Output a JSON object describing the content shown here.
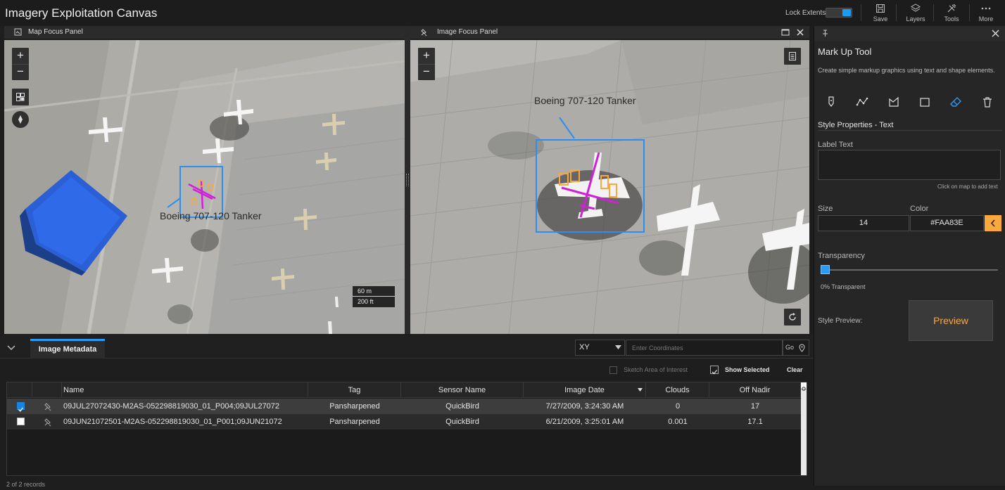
{
  "app": {
    "title": "Imagery Exploitation Canvas"
  },
  "header": {
    "lock_extents_label": "Lock Extents",
    "lock_extents_on": true,
    "tools": [
      {
        "label": "Save",
        "icon": "save-icon"
      },
      {
        "label": "Layers",
        "icon": "layers-icon"
      },
      {
        "label": "Tools",
        "icon": "tools-icon"
      },
      {
        "label": "More",
        "icon": "more-icon"
      }
    ]
  },
  "map_panel": {
    "title": "Map Focus Panel",
    "annotation_label": "Boeing 707-120 Tanker",
    "scale_m": "60 m",
    "scale_ft": "200 ft"
  },
  "image_panel": {
    "title": "Image Focus Panel",
    "annotation_label": "Boeing 707-120 Tanker"
  },
  "markup": {
    "title": "Mark Up Tool",
    "description": "Create simple markup graphics using text and shape elements.",
    "style_props_title": "Style Properties - Text",
    "label_text_label": "Label Text",
    "label_text_value": "",
    "hint": "Click on map to add text",
    "size_label": "Size",
    "size_value": "14",
    "color_label": "Color",
    "color_value": "#FAA83E",
    "transparency_label": "Transparency",
    "transparency_value": "0% Transparent",
    "transparency_fraction": 0,
    "style_preview_label": "Style Preview:",
    "preview_text": "Preview",
    "accent": "#faa83e",
    "active_tool": "eraser-icon"
  },
  "bottom": {
    "tab_label": "Image Metadata",
    "coord_mode": "XY",
    "coord_placeholder": "Enter Coordinates",
    "go_label": "Go",
    "sketch_label": "Sketch Area of Interest",
    "show_selected_label": "Show Selected",
    "clear_label": "Clear",
    "records_label": "2 of 2 records"
  },
  "table": {
    "columns": [
      "Name",
      "Tag",
      "Sensor Name",
      "Image Date",
      "Clouds",
      "Off Nadir"
    ],
    "rows": [
      {
        "selected": true,
        "name": "09JUL27072430-M2AS-052298819030_01_P004;09JUL27072",
        "tag": "Pansharpened",
        "sensor": "QuickBird",
        "date": "7/27/2009, 3:24:30 AM",
        "clouds": "0",
        "nadir": "17"
      },
      {
        "selected": false,
        "name": "09JUN21072501-M2AS-052298819030_01_P001;09JUN21072",
        "tag": "Pansharpened",
        "sensor": "QuickBird",
        "date": "6/21/2009, 3:25:01 AM",
        "clouds": "0.001",
        "nadir": "17.1"
      }
    ]
  }
}
